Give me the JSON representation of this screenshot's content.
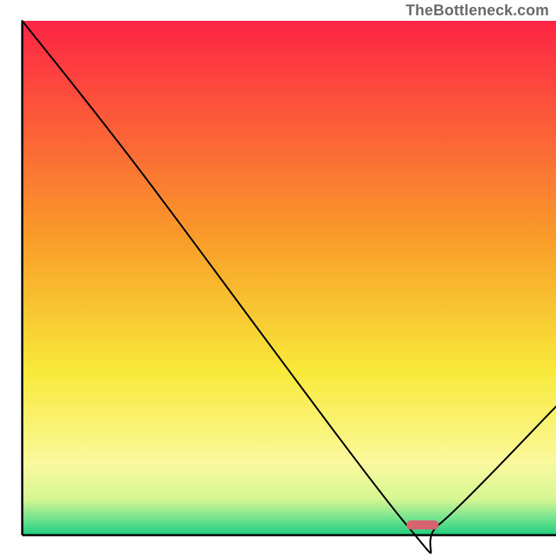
{
  "watermark": "TheBottleneck.com",
  "chart_data": {
    "type": "line",
    "title": "",
    "xlabel": "",
    "ylabel": "",
    "xlim": [
      0,
      100
    ],
    "ylim": [
      0,
      100
    ],
    "legend": false,
    "grid": false,
    "axes_visible": {
      "left": true,
      "bottom": true,
      "top": false,
      "right": false
    },
    "series": [
      {
        "name": "bottleneck-curve",
        "x": [
          0,
          22,
          72,
          78,
          100
        ],
        "y": [
          100,
          71,
          2,
          2,
          25
        ]
      }
    ],
    "marker": {
      "name": "optimal-range-marker",
      "x_start": 72,
      "x_end": 78,
      "y": 2,
      "color": "#d6636f"
    },
    "background_gradient": {
      "stops": [
        {
          "pos": 0.0,
          "color": "#fd2445"
        },
        {
          "pos": 0.43,
          "color": "#f99e29"
        },
        {
          "pos": 0.68,
          "color": "#f8e938"
        },
        {
          "pos": 0.86,
          "color": "#faf99d"
        },
        {
          "pos": 0.93,
          "color": "#d6f693"
        },
        {
          "pos": 0.965,
          "color": "#7ae58f"
        },
        {
          "pos": 1.0,
          "color": "#1fcd80"
        }
      ]
    },
    "axis_color": "#000000",
    "curve_color": "#000000"
  }
}
